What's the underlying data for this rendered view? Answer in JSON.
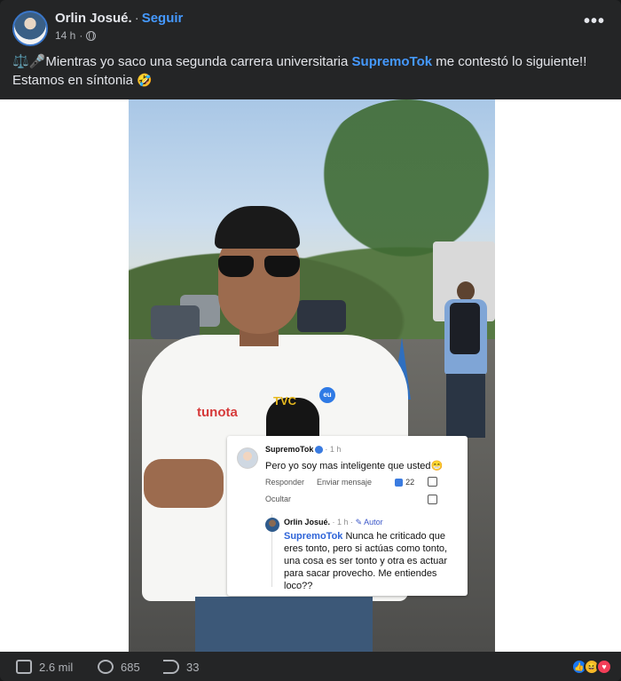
{
  "post": {
    "author": "Orlin Josué.",
    "separator": "·",
    "follow_label": "Seguir",
    "time": "14 h",
    "dot": "·",
    "more_label": "•••",
    "caption_prefix": "⚖️🎤Mientras yo saco una segunda carrera universitaria ",
    "caption_mention": "SupremoTok",
    "caption_suffix": " me contestó lo siguiente!! Estamos en síntonia ",
    "caption_emoji": "🤣"
  },
  "photo": {
    "shirt_brand": "tunota",
    "mic_brand": "TVC",
    "badge": "eu"
  },
  "comment": {
    "user": "SupremoTok",
    "time": "· 1 h",
    "text": "Pero yo soy mas inteligente que usted😁",
    "reply_label": "Responder",
    "send_message_label": "Enviar mensaje",
    "likes": "22",
    "hide_label": "Ocultar"
  },
  "reply": {
    "user": "Orlin Josué.",
    "time": "· 1 h ·",
    "author_badge": "✎ Autor",
    "mention": "SupremoTok",
    "text": " Nunca he criticado que eres tonto, pero si actúas como tonto, una cosa es ser tonto  y otra es actuar para sacar provecho. Me entiendes loco??"
  },
  "footer": {
    "likes": "2.6 mil",
    "comments": "685",
    "shares": "33"
  },
  "colors": {
    "background": "#242526",
    "link": "#4599ff",
    "text": "#e4e6eb",
    "muted": "#b0b3b8"
  }
}
